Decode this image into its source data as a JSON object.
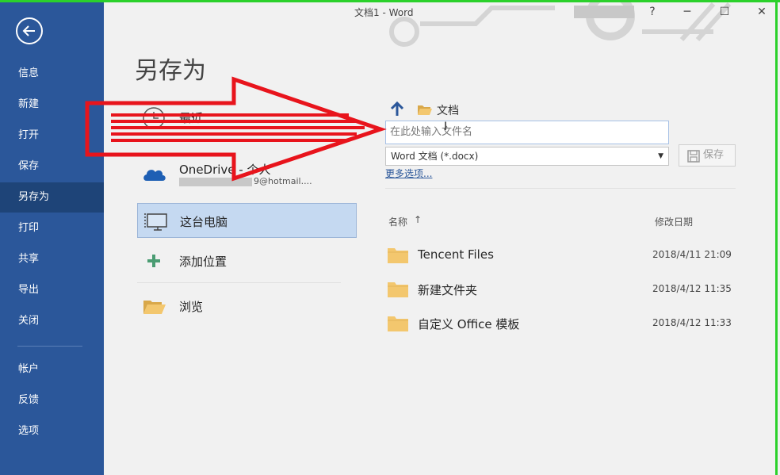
{
  "window": {
    "title": "文档1  -  Word",
    "help": "?",
    "minimize": "─",
    "maximize": "☐",
    "close": "✕"
  },
  "sidebar": {
    "items": [
      {
        "label": "信息"
      },
      {
        "label": "新建"
      },
      {
        "label": "打开"
      },
      {
        "label": "保存"
      },
      {
        "label": "另存为",
        "active": true
      },
      {
        "label": "打印"
      },
      {
        "label": "共享"
      },
      {
        "label": "导出"
      },
      {
        "label": "关闭"
      },
      {
        "label": "帐户"
      },
      {
        "label": "反馈"
      },
      {
        "label": "选项"
      }
    ]
  },
  "page_title": "另存为",
  "locations": {
    "recent": "最近",
    "onedrive": "OneDrive - 个人",
    "onedrive_account": "9@hotmail....",
    "this_pc": "这台电脑",
    "add_place": "添加位置",
    "browse": "浏览"
  },
  "save_panel": {
    "current_folder": "文档",
    "filename_placeholder": "在此处输入文件名",
    "file_type": "Word 文档 (*.docx)",
    "save_label": "保存",
    "more_options": "更多选项..."
  },
  "file_list": {
    "col_name": "名称",
    "sort_indicator": "↑",
    "col_date": "修改日期",
    "rows": [
      {
        "name": "Tencent Files",
        "date": "2018/4/11 21:09"
      },
      {
        "name": "新建文件夹",
        "date": "2018/4/12 11:35"
      },
      {
        "name": "自定义 Office 模板",
        "date": "2018/4/12 11:33"
      }
    ]
  },
  "colors": {
    "sidebar": "#2b579a",
    "sidebar_active": "#1e4478",
    "selected_location": "#c5d9f1",
    "annotation_arrow": "#e8141c",
    "frame": "#2bd12b"
  }
}
